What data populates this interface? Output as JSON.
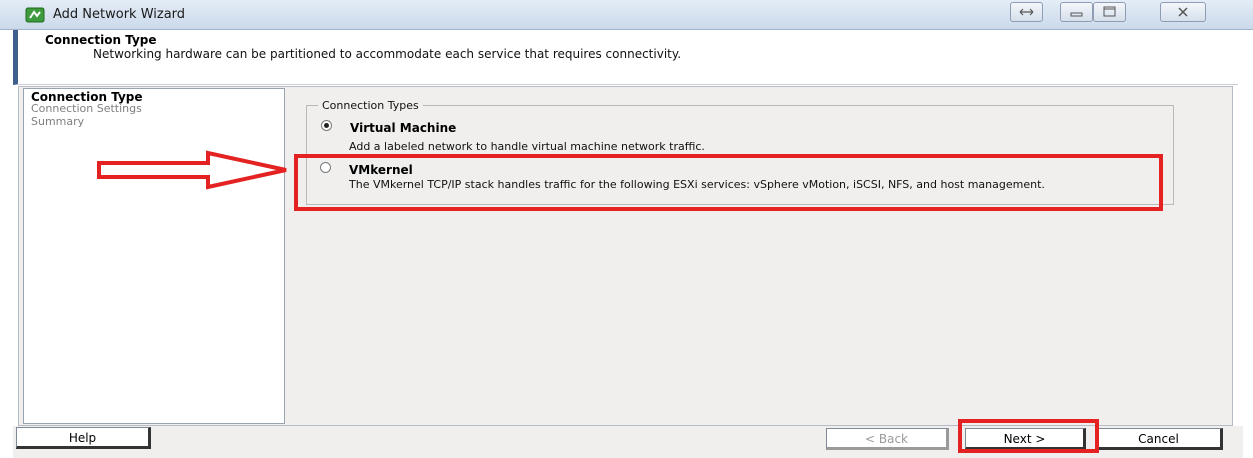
{
  "window": {
    "title": "Add Network Wizard",
    "icon": "network-wizard-icon"
  },
  "header": {
    "title": "Connection Type",
    "description": "Networking hardware can be partitioned to accommodate each service that requires connectivity."
  },
  "steps": [
    {
      "label": "Connection Type",
      "active": true
    },
    {
      "label": "Connection Settings",
      "active": false
    },
    {
      "label": "Summary",
      "active": false
    }
  ],
  "connection_types": {
    "legend": "Connection Types",
    "selected": "Virtual Machine",
    "options": [
      {
        "label": "Virtual Machine",
        "description": "Add a labeled network to handle virtual machine network traffic."
      },
      {
        "label": "VMkernel",
        "description": "The VMkernel TCP/IP stack handles traffic for the following ESXi services: vSphere vMotion, iSCSI, NFS, and host management."
      }
    ]
  },
  "footer": {
    "help": "Help",
    "back": "< Back",
    "next": "Next >",
    "cancel": "Cancel"
  },
  "colors": {
    "highlight": "#e52222",
    "header_accent": "#3f5f8f"
  }
}
